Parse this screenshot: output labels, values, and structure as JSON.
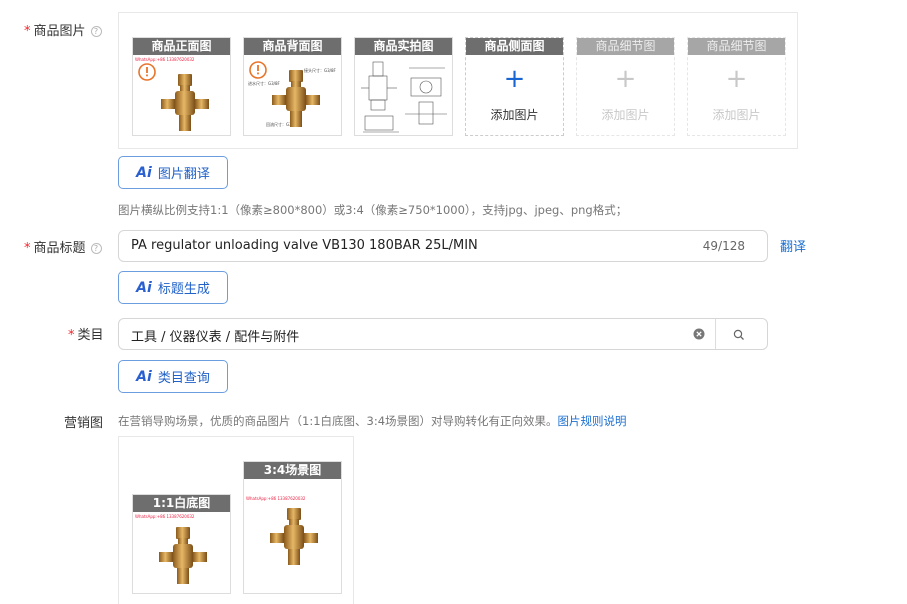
{
  "product_images": {
    "label": "商品图片",
    "help_icon": "question-circle-icon",
    "slots": [
      {
        "title": "商品正面图",
        "watermark": "WhatsApp:+86 13387620032"
      },
      {
        "title": "商品背面图",
        "note_top": "接头尺寸：G3/8F",
        "note_mid": "进水尺寸：G3/8F",
        "note_bottom": "回流尺寸：G3/8F"
      },
      {
        "title": "商品实拍图"
      },
      {
        "title": "商品侧面图",
        "add_text": "添加图片"
      },
      {
        "title": "商品细节图",
        "add_text": "添加图片"
      },
      {
        "title": "商品细节图",
        "add_text": "添加图片"
      }
    ],
    "ai_button": "图片翻译",
    "hint": "图片横纵比例支持1:1（像素≥800*800）或3:4（像素≥750*1000），支持jpg、jpeg、png格式；"
  },
  "product_title": {
    "label": "商品标题",
    "value": "PA regulator unloading valve VB130 180BAR 25L/MIN",
    "counter": "49/128",
    "translate_link": "翻译",
    "ai_button": "标题生成"
  },
  "category": {
    "label": "类目",
    "value": "工具 / 仪器仪表 / 配件与附件",
    "ai_button": "类目查询"
  },
  "marketing": {
    "label": "营销图",
    "hint": "在营销导购场景，优质的商品图片（1:1白底图、3:4场景图）对导购转化有正向效果。",
    "hint_link": "图片规则说明",
    "slots": [
      {
        "title": "1:1白底图",
        "watermark": "WhatsApp:+86 13387620032"
      },
      {
        "title": "3:4场景图",
        "watermark": "WhatsApp:+86 13387620032"
      }
    ]
  },
  "colors": {
    "accent": "#1b6fd1",
    "required": "#f5222d",
    "brass": "#c8963a"
  }
}
